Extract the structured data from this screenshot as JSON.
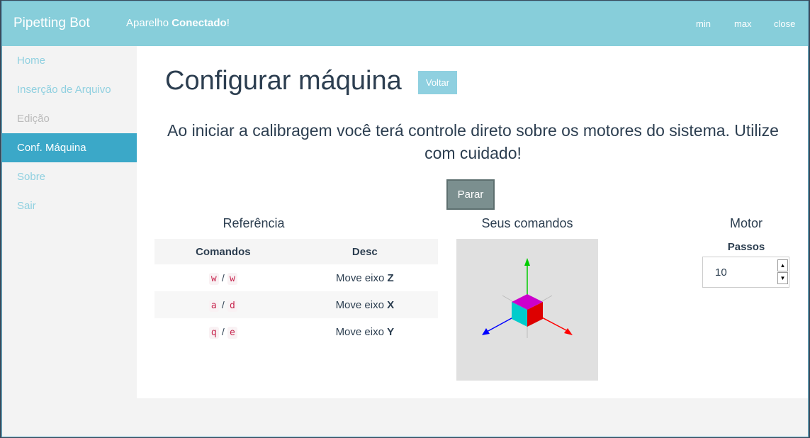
{
  "app": {
    "title": "Pipetting Bot",
    "status_prefix": "Aparelho ",
    "status_strong": "Conectado",
    "status_suffix": "!",
    "window_controls": {
      "min": "min",
      "max": "max",
      "close": "close"
    }
  },
  "sidebar": {
    "items": [
      {
        "label": "Home",
        "state": "normal"
      },
      {
        "label": "Inserção de Arquivo",
        "state": "normal"
      },
      {
        "label": "Edição",
        "state": "disabled"
      },
      {
        "label": "Conf. Máquina",
        "state": "active"
      },
      {
        "label": "Sobre",
        "state": "normal"
      },
      {
        "label": "Sair",
        "state": "normal"
      }
    ]
  },
  "main": {
    "title": "Configurar máquina",
    "back_label": "Voltar",
    "intro": "Ao iniciar a calibragem você terá controle direto sobre os motores do sistema. Utilize com cuidado!",
    "stop_label": "Parar",
    "reference": {
      "title": "Referência",
      "headers": [
        "Comandos",
        "Desc"
      ],
      "rows": [
        {
          "key1": "w",
          "sep": "/",
          "key2": "w",
          "desc_prefix": "Move eixo ",
          "axis": "Z"
        },
        {
          "key1": "a",
          "sep": "/",
          "key2": "d",
          "desc_prefix": "Move eixo ",
          "axis": "X"
        },
        {
          "key1": "q",
          "sep": "/",
          "key2": "e",
          "desc_prefix": "Move eixo ",
          "axis": "Y"
        }
      ]
    },
    "commands": {
      "title": "Seus comandos"
    },
    "motor": {
      "title": "Motor",
      "steps_label": "Passos",
      "steps_value": "10"
    }
  },
  "colors": {
    "topbar": "#87ceda",
    "accent": "#3ba8c8",
    "axis_x": "#ff0000",
    "axis_y": "#00cc00",
    "axis_z": "#0000ff"
  }
}
